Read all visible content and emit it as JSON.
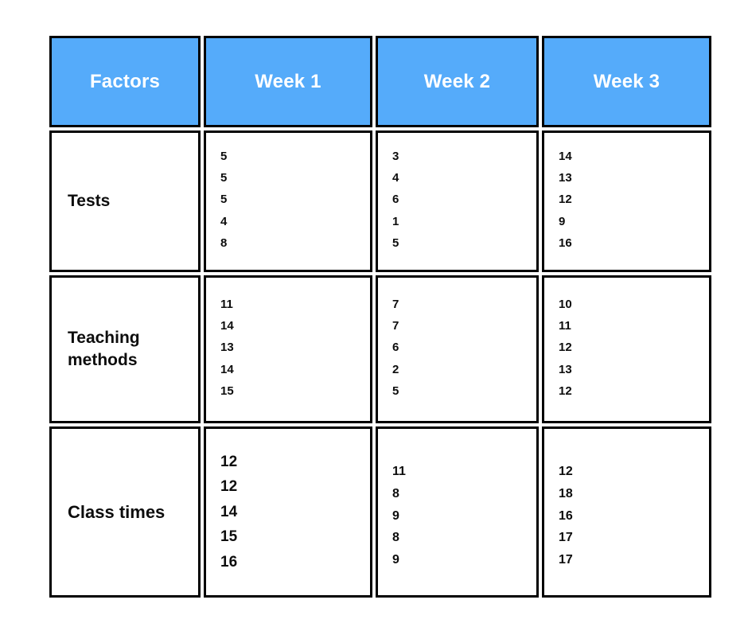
{
  "table": {
    "columns": [
      "Factors",
      "Week 1",
      "Week 2",
      "Week 3"
    ],
    "header_bg": "#55abfa",
    "header_text_color": "#ffffff",
    "border_color": "#000000",
    "rows": [
      {
        "factor": "Tests",
        "week1": [
          "5",
          "5",
          "5",
          "4",
          "8"
        ],
        "week2": [
          "3",
          "4",
          "6",
          "1",
          "5"
        ],
        "week3": [
          "14",
          "13",
          "12",
          "9",
          "16"
        ]
      },
      {
        "factor": "Teaching methods",
        "week1": [
          "11",
          "14",
          "13",
          "14",
          "15"
        ],
        "week2": [
          "7",
          "7",
          "6",
          "2",
          "5"
        ],
        "week3": [
          "10",
          "11",
          "12",
          "13",
          "12"
        ]
      },
      {
        "factor": "Class times",
        "week1": [
          "12",
          "12",
          "14",
          "15",
          "16"
        ],
        "week2": [
          "11",
          "8",
          "9",
          "8",
          "9"
        ],
        "week3": [
          "12",
          "18",
          "16",
          "17",
          "17"
        ]
      }
    ]
  }
}
